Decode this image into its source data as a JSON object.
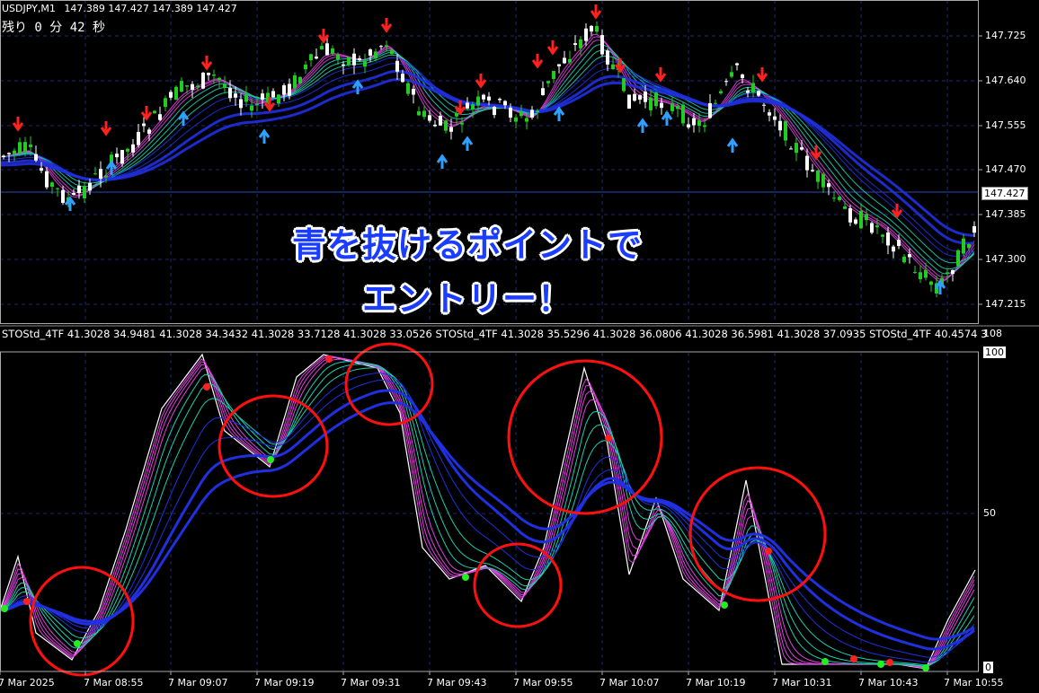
{
  "chart_header": {
    "symbol": "USDJPY,M1",
    "ohlc": "147.389 147.427 147.389 147.427",
    "countdown": "残り 0 分 42 秒"
  },
  "price_axis": {
    "labels": [
      "147.725",
      "147.640",
      "147.555",
      "147.470",
      "147.385",
      "147.300",
      "147.215"
    ],
    "current_price": "147.427"
  },
  "indicator": {
    "header": "STOStd_4TF 41.3028 34.9481 41.3028 34.3432 41.3028 33.7128 41.3028 33.0526   STOStd_4TF 41.3028 35.5296 41.3028 36.0806 41.3028 36.5981 41.3028 37.0935   STOStd_4TF 40.4574 3",
    "axis_labels": [
      "108",
      "100",
      "50",
      "0"
    ]
  },
  "time_axis": {
    "labels": [
      "7 Mar 2025",
      "7 Mar 08:55",
      "7 Mar 09:07",
      "7 Mar 09:19",
      "7 Mar 09:31",
      "7 Mar 09:43",
      "7 Mar 09:55",
      "7 Mar 10:07",
      "7 Mar 10:19",
      "7 Mar 10:31",
      "7 Mar 10:43",
      "7 Mar 10:55"
    ]
  },
  "annotation": {
    "line1": "青を抜けるポイントで",
    "line2": "エントリー！"
  },
  "colors": {
    "background": "#000000",
    "bull_candle": "#22cc22",
    "bear_candle": "#ffffff",
    "grid": "#1b2a6b",
    "ribbon_outer": "#2030e0",
    "ribbon_teal": "#1ad0b0",
    "ribbon_magenta": "#e040e0",
    "sell_arrow": "#ff2020",
    "buy_arrow": "#30a0ff",
    "highlight_circle": "#ff1010"
  }
}
